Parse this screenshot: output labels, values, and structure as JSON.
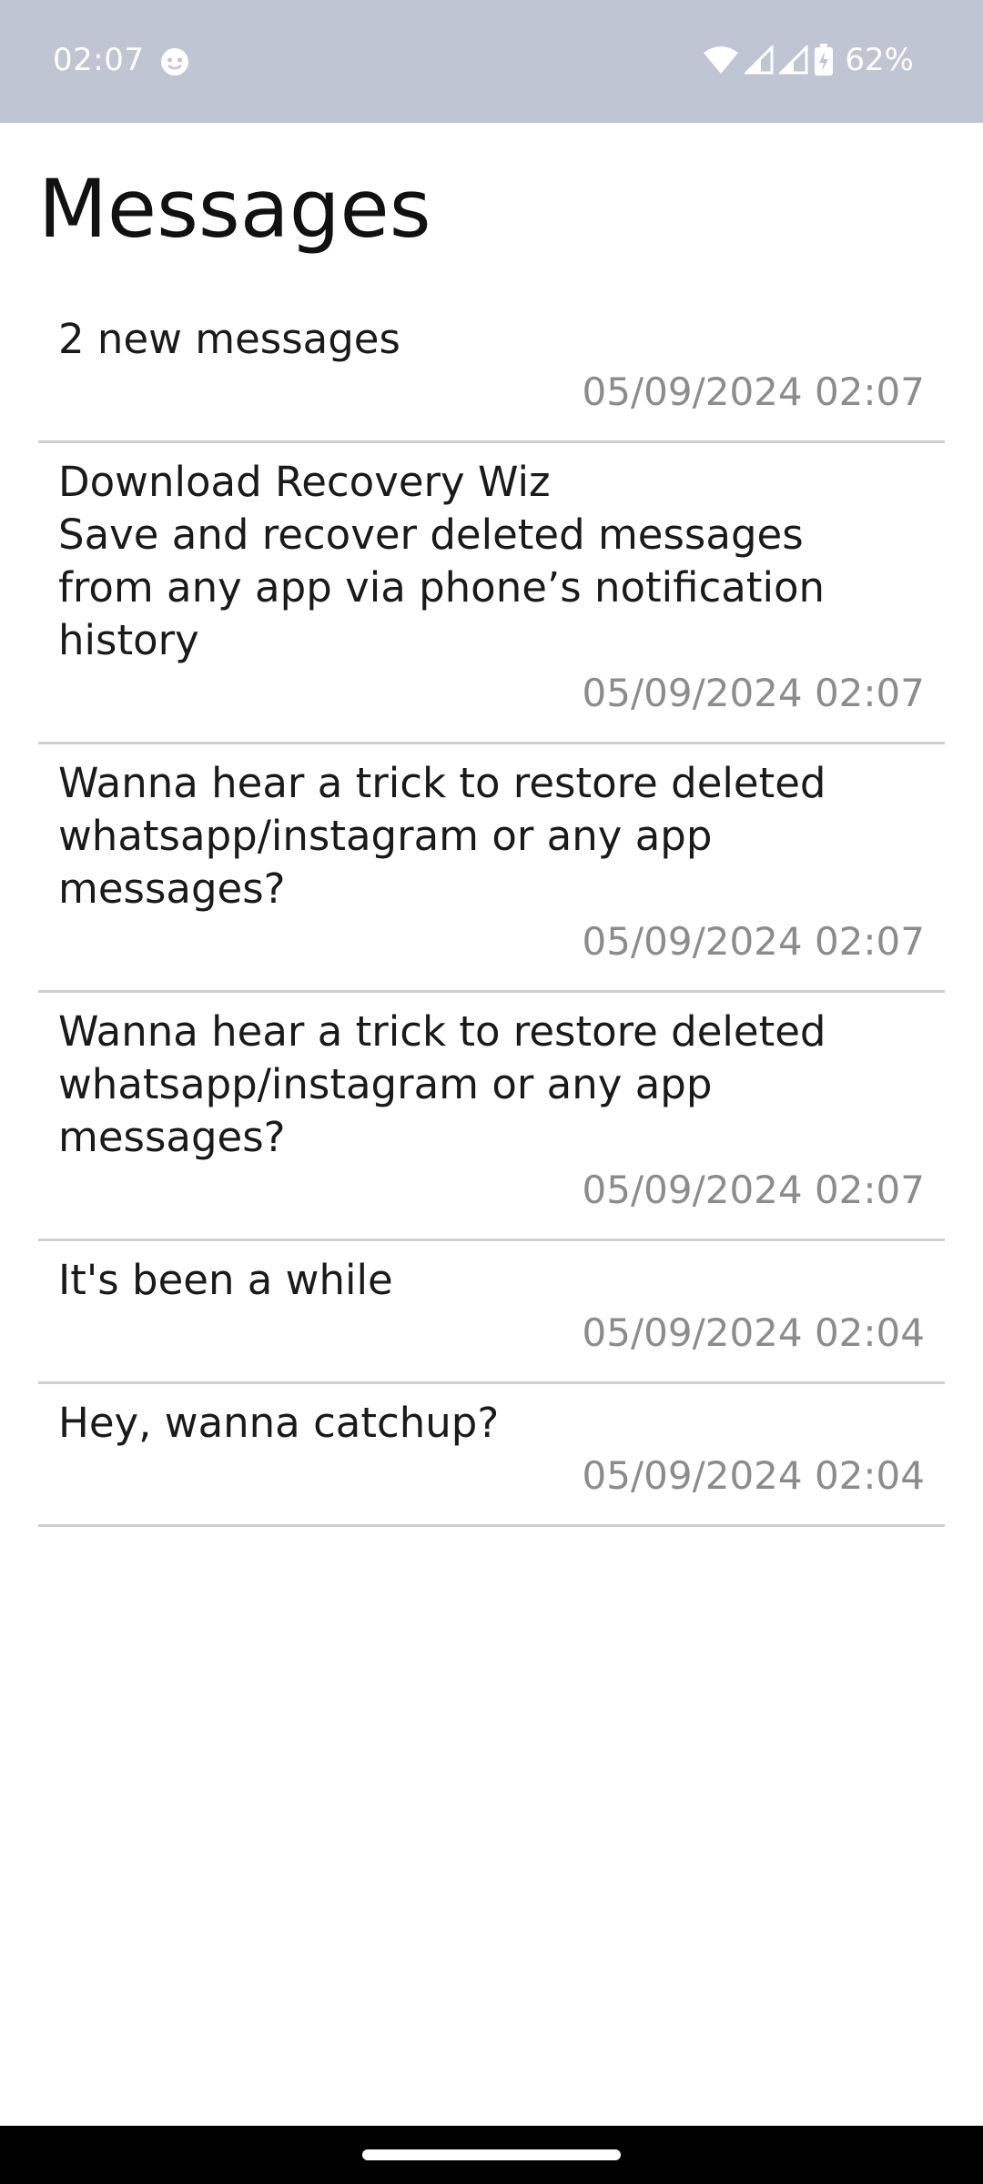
{
  "status_bar": {
    "time": "02:07",
    "battery_percent": "62%",
    "icons": [
      "face-icon",
      "wifi-icon",
      "signal-icon",
      "signal-icon",
      "battery-charging-icon"
    ]
  },
  "screen": {
    "title": "Messages"
  },
  "messages": [
    {
      "text": "2 new messages",
      "timestamp": "05/09/2024 02:07"
    },
    {
      "text": "Download Recovery Wiz\nSave and recover deleted messages\nfrom any app via phone’s notification\nhistory",
      "timestamp": "05/09/2024 02:07"
    },
    {
      "text": "Wanna hear a trick to restore deleted\nwhatsapp/instagram or any app\nmessages?",
      "timestamp": "05/09/2024 02:07"
    },
    {
      "text": "Wanna hear a trick to restore deleted\nwhatsapp/instagram or any app\nmessages?",
      "timestamp": "05/09/2024 02:07"
    },
    {
      "text": "It's been a while",
      "timestamp": "05/09/2024 02:04"
    },
    {
      "text": "Hey, wanna catchup?",
      "timestamp": "05/09/2024 02:04"
    }
  ],
  "colors": {
    "status_bar_bg": "#c0c5d3",
    "divider": "#cfcfcf",
    "timestamp": "#8c8c8c"
  }
}
